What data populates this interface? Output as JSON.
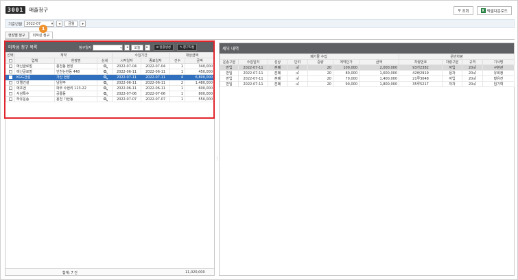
{
  "header": {
    "code": "3001",
    "title": "매출청구",
    "search_label": "조회",
    "excel_label": "엑셀다운로드"
  },
  "filter": {
    "label": "기준년월",
    "value": "2022-07",
    "nav_label": "금월"
  },
  "tabs": [
    {
      "label": "현장별 청구"
    },
    {
      "label": "미작성 청구"
    }
  ],
  "marker": "1",
  "left": {
    "title": "미작성 청구 목록",
    "date_label": "청구일자",
    "today_label": "오늘",
    "btn_bulk": "일괄생성",
    "btn_claim": "청구작성",
    "group_headers": {
      "select": "선택",
      "contract": "계약",
      "period": "수집기간",
      "target": "대상금액"
    },
    "columns": [
      "업체",
      "현장명",
      "상세",
      "시작일자",
      "종료일자",
      "건수",
      "금액"
    ],
    "rows": [
      {
        "company": "에신글로벌",
        "site": "풍천동 현장",
        "start": "2022-07-04",
        "end": "2022-07-04",
        "count": "1",
        "amount": "340,000"
      },
      {
        "company": "에신글로벌",
        "site": "인천논현동 448",
        "start": "2022-06-11",
        "end": "2022-06-11",
        "count": "1",
        "amount": "450,000"
      },
      {
        "company": "KGG건설",
        "site": "가산 현장",
        "start": "2022-07-11",
        "end": "2022-07-11",
        "count": "4",
        "amount": "6,800,000"
      },
      {
        "company": "미엘건설",
        "site": "남양주",
        "start": "2022-06-11",
        "end": "2022-06-11",
        "count": "2",
        "amount": "1,480,000"
      },
      {
        "company": "에프엔",
        "site": "파주 수현리 123-22",
        "start": "2022-06-11",
        "end": "2022-06-11",
        "count": "1",
        "amount": "600,000"
      },
      {
        "company": "서삼톡수",
        "site": "공룡동",
        "start": "2022-07-06",
        "end": "2022-07-06",
        "count": "1",
        "amount": "800,000"
      },
      {
        "company": "하유운송",
        "site": "용천 가산동",
        "start": "2022-07-07",
        "end": "2022-07-07",
        "count": "1",
        "amount": "550,000"
      }
    ],
    "footer_sum": "합계: 7 건",
    "footer_amount": "11,020,000"
  },
  "right": {
    "title": "세부 내역",
    "group_headers": {
      "waste": "폐기물 수집",
      "vehicle": "운반차량"
    },
    "columns": [
      "운송구분",
      "수집일자",
      "성상",
      "단위",
      "중량",
      "계약단가",
      "금액",
      "차량번호",
      "차량구분",
      "규격",
      "기사명"
    ],
    "rows": [
      {
        "type": "반입",
        "date": "2022-07-11",
        "kind": "혼폐",
        "unit": "㎥",
        "weight": "20",
        "price": "100,000",
        "amount": "2,000,000",
        "plate": "93가2382",
        "vtype": "자입",
        "spec": "20㎥",
        "driver": "구본관"
      },
      {
        "type": "반입",
        "date": "2022-07-11",
        "kind": "혼폐",
        "unit": "㎥",
        "weight": "20",
        "price": "80,000",
        "amount": "1,600,000",
        "plate": "42바2919",
        "vtype": "용차",
        "spec": "20㎥",
        "driver": "유회정"
      },
      {
        "type": "반입",
        "date": "2022-07-11",
        "kind": "혼폐",
        "unit": "㎥",
        "weight": "20",
        "price": "70,000",
        "amount": "1,400,000",
        "plate": "21루3048",
        "vtype": "자입",
        "spec": "20㎥",
        "driver": "황유진"
      },
      {
        "type": "반입",
        "date": "2022-07-11",
        "kind": "혼폐",
        "unit": "㎥",
        "weight": "20",
        "price": "90,000",
        "amount": "1,800,000",
        "plate": "35루5217",
        "vtype": "자차",
        "spec": "20㎥",
        "driver": "임기혁"
      }
    ]
  },
  "colors": {
    "panel_title": "#5f6063",
    "selected_row": "#2f6fbd",
    "highlight_box": "#e0242a",
    "marker": "#f0902a"
  },
  "icons": [
    "search-icon",
    "excel-icon",
    "chevron-left-icon",
    "chevron-right-icon",
    "magnifier-icon",
    "calendar-icon"
  ]
}
